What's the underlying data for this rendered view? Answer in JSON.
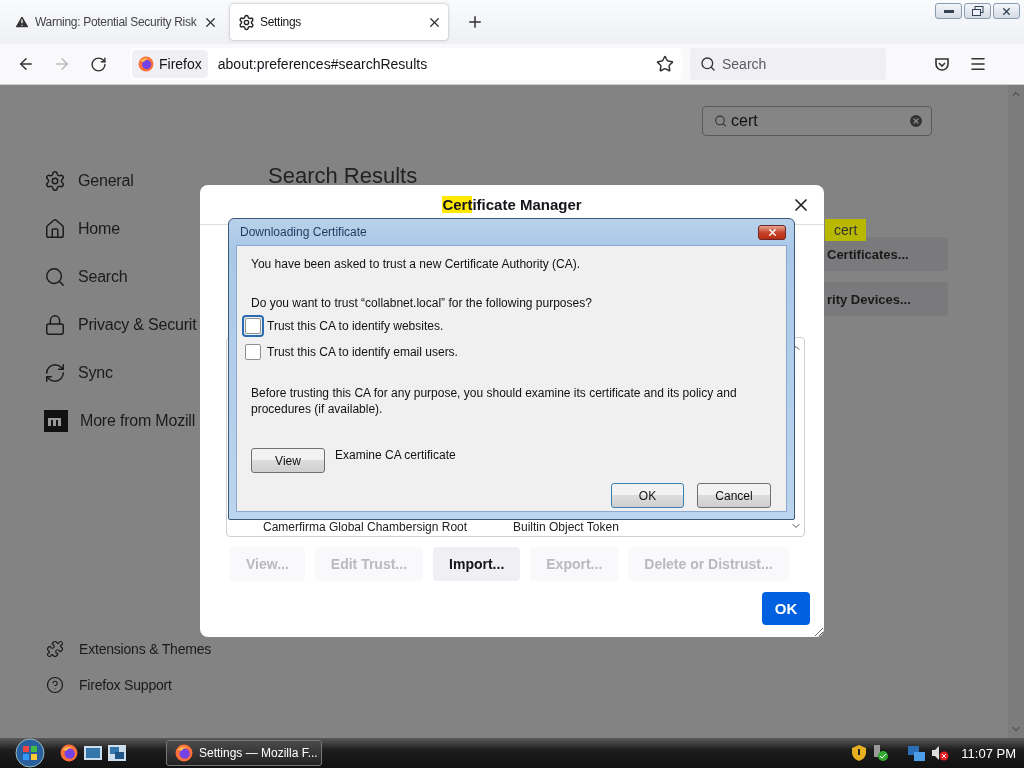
{
  "tabs": [
    {
      "kind": "warning",
      "title": "Warning: Potential Security Risk",
      "selected": false
    },
    {
      "kind": "settings",
      "title": "Settings",
      "selected": true
    }
  ],
  "address_bar": {
    "identity": "Firefox",
    "url": "about:preferences#searchResults"
  },
  "search_bar": {
    "placeholder": "Search"
  },
  "sidebar": {
    "items": [
      {
        "kind": "gear",
        "label": "General"
      },
      {
        "kind": "home",
        "label": "Home"
      },
      {
        "kind": "search",
        "label": "Search"
      },
      {
        "kind": "lock",
        "label": "Privacy & Securit"
      },
      {
        "kind": "sync",
        "label": "Sync"
      },
      {
        "kind": "mozilla",
        "label": "More from Mozill"
      }
    ],
    "footer_items": [
      {
        "kind": "puzzle",
        "label": "Extensions & Themes"
      },
      {
        "kind": "help",
        "label": "Firefox Support"
      }
    ]
  },
  "search_field": {
    "value": "cert"
  },
  "heading": "Search Results",
  "match_tooltip": "cert",
  "side_buttons": [
    {
      "label": "Certificates..."
    },
    {
      "label": "rity Devices..."
    }
  ],
  "certificate_manager": {
    "title": "Certificate Manager",
    "highlighted": true,
    "rows": [
      {
        "name": "Camerfirma Global Chambersign Root",
        "device": "Builtin Object Token"
      }
    ],
    "buttons": [
      {
        "label": "View...",
        "disabled": true
      },
      {
        "label": "Edit Trust...",
        "disabled": true
      },
      {
        "label": "Import...",
        "disabled": false
      },
      {
        "label": "Export...",
        "disabled": true
      },
      {
        "label": "Delete or Distrust...",
        "disabled": true
      }
    ],
    "ok": "OK"
  },
  "download_dialog": {
    "title": "Downloading Certificate",
    "intro": "You have been asked to trust a new Certificate Authority (CA).",
    "question": "Do you want to trust “collabnet.local” for the following purposes?",
    "options": [
      {
        "label": "Trust this CA to identify websites.",
        "checked": false,
        "focused": true
      },
      {
        "label": "Trust this CA to identify email users.",
        "checked": false,
        "focused": false
      }
    ],
    "note": "Before trusting this CA for any purpose, you should examine its certificate and its policy and procedures (if available).",
    "view_button": "View",
    "view_caption": "Examine CA certificate",
    "ok": "OK",
    "cancel": "Cancel"
  },
  "taskbar": {
    "tasks": [
      {
        "label": "Settings — Mozilla F..."
      }
    ],
    "clock": "11:07 PM"
  }
}
